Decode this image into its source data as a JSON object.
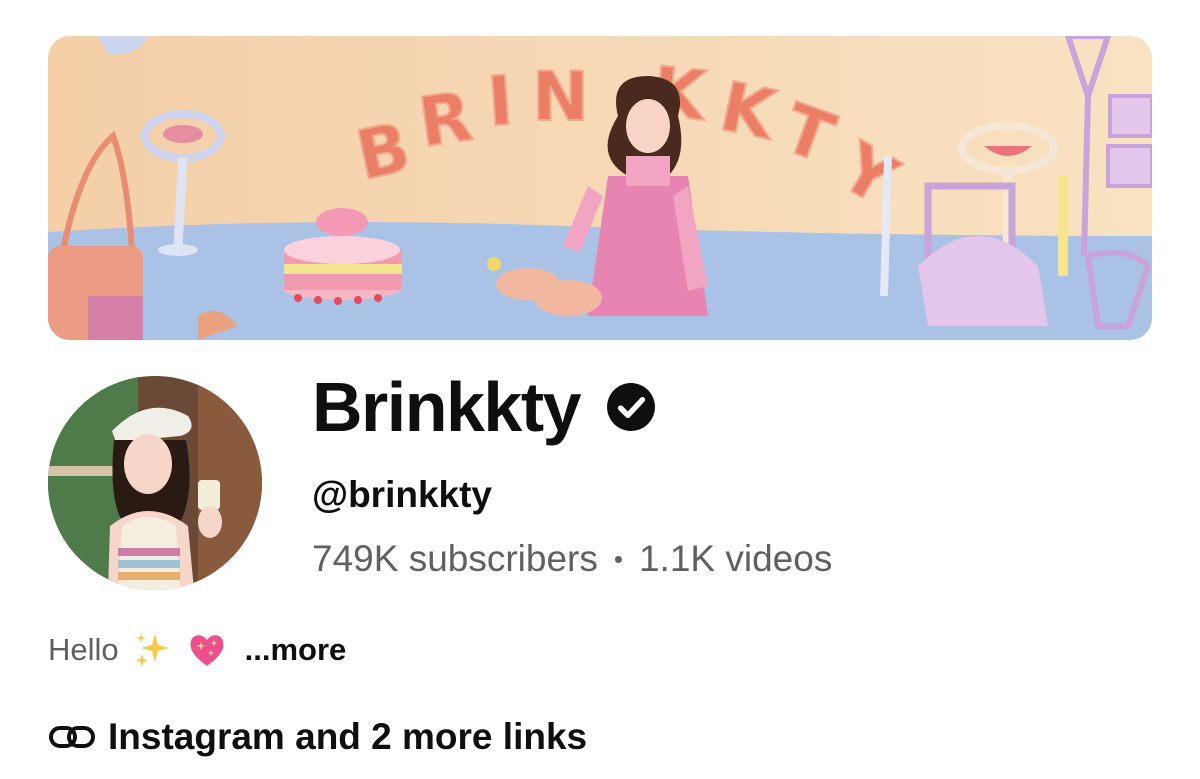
{
  "banner": {
    "art_text": "BRINKKTY",
    "colors": {
      "wall": "#f7d9b6",
      "floor": "#a9c2e6",
      "letters": "#ea7f66"
    }
  },
  "channel": {
    "name": "Brinkkty",
    "verified_icon": "verified-check-icon",
    "handle": "@brinkkty",
    "subscribers": "749K subscribers",
    "separator": "•",
    "videos": "1.1K videos"
  },
  "description": {
    "text": "Hello",
    "emojis": [
      "sparkles-icon",
      "sparkling-heart-icon"
    ],
    "more_label": "...more"
  },
  "links": {
    "icon": "link-icon",
    "label": "Instagram and 2 more links"
  }
}
